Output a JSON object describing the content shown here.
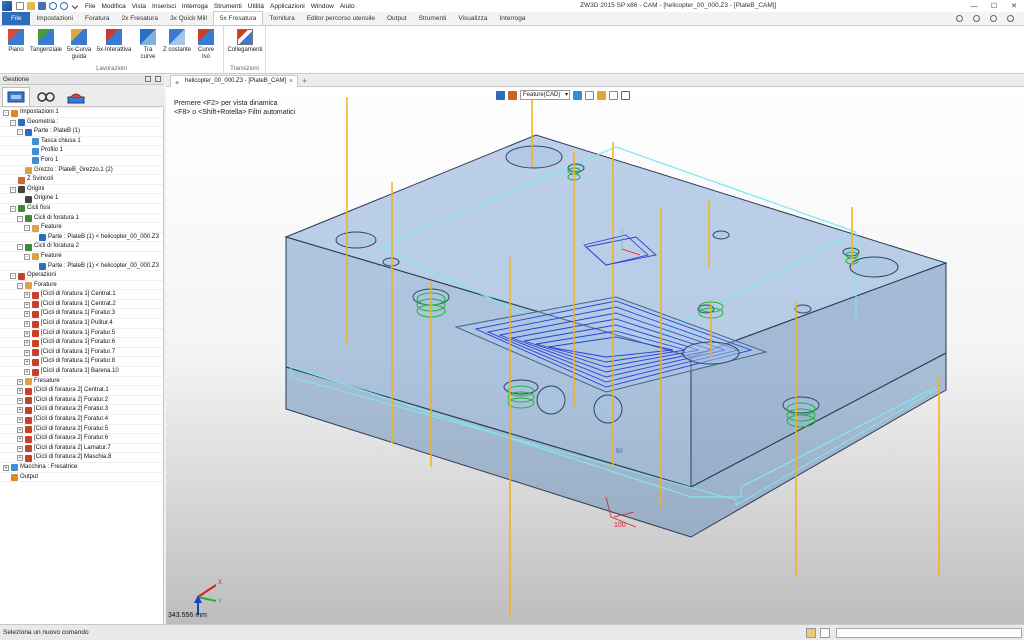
{
  "app": {
    "title": "ZW3D 2015 SP x86 - CAM - [helicopter_00_000.Z3 - [PlateB_CAM]]",
    "menu": [
      "File",
      "Modifica",
      "Vista",
      "Inserisci",
      "Interroga",
      "Strumenti",
      "Utilità",
      "Applicazioni",
      "Window",
      "Aiuto"
    ]
  },
  "ribbon": {
    "tabs": [
      "File",
      "Impostazioni",
      "Foratura",
      "2x Fresatura",
      "3x Quick Mill",
      "5x Fresatura",
      "Tornitura",
      "Editor percorso utensile",
      "Output",
      "Strumenti",
      "Visualizza",
      "Interroga"
    ],
    "active_tab": "5x Fresatura",
    "groups": [
      {
        "label": "Lavorazioni",
        "buttons": [
          {
            "label": "Piano",
            "icon": "plane-icon"
          },
          {
            "label": "Tangenziale",
            "icon": "tangential-icon"
          },
          {
            "label": "5x-Curva guida",
            "icon": "guide-curve-icon"
          },
          {
            "label": "5x-Interattiva",
            "icon": "interactive-icon"
          },
          {
            "label": "Tra curve",
            "icon": "between-curves-icon"
          },
          {
            "label": "Z costante",
            "icon": "z-constant-icon"
          },
          {
            "label": "Curve Iso",
            "icon": "iso-curve-icon"
          }
        ]
      },
      {
        "label": "Transizioni",
        "buttons": [
          {
            "label": "Collegamenti",
            "icon": "links-icon"
          }
        ]
      }
    ]
  },
  "left_panel": {
    "title": "Gestione",
    "tabs": [
      "manager-icon",
      "view-icon",
      "cam-icon"
    ],
    "tree": [
      {
        "label": "Impostazioni 1",
        "level": 0,
        "exp": "-",
        "icon": "#d98a2a"
      },
      {
        "label": "Geometria :",
        "level": 1,
        "exp": "-",
        "icon": "#2a6fc2"
      },
      {
        "label": "Parte : PlateB (1)",
        "level": 2,
        "exp": "-",
        "icon": "#2a6fc2"
      },
      {
        "label": "Tasca chiusa 1",
        "level": 3,
        "exp": "",
        "icon": "#3d8fd6"
      },
      {
        "label": "Profilo 1",
        "level": 3,
        "exp": "",
        "icon": "#3d8fd6"
      },
      {
        "label": "Foro 1",
        "level": 3,
        "exp": "",
        "icon": "#3d8fd6"
      },
      {
        "label": "Grezzo : PlateB_Grezzo.1 (2)",
        "level": 2,
        "exp": "",
        "icon": "#d9a24a"
      },
      {
        "label": "Z Svincoli",
        "level": 1,
        "exp": "",
        "icon": "#c86a2a"
      },
      {
        "label": "Origini",
        "level": 1,
        "exp": "-",
        "icon": "#444444"
      },
      {
        "label": "Origine 1",
        "level": 2,
        "exp": "",
        "icon": "#444444"
      },
      {
        "label": "Cicli fissi",
        "level": 1,
        "exp": "-",
        "icon": "#3a8a3a"
      },
      {
        "label": "Cicli di foratura 1",
        "level": 2,
        "exp": "-",
        "icon": "#3a8a3a"
      },
      {
        "label": "Feature",
        "level": 3,
        "exp": "-",
        "icon": "#d9a24a"
      },
      {
        "label": "Parte : PlateB (1) < helicopter_00_000.Z3",
        "level": 4,
        "exp": "",
        "icon": "#2a6fc2"
      },
      {
        "label": "Cicli di foratura 2",
        "level": 2,
        "exp": "-",
        "icon": "#3a8a3a"
      },
      {
        "label": "Feature",
        "level": 3,
        "exp": "-",
        "icon": "#d9a24a"
      },
      {
        "label": "Parte : PlateB (1) < helicopter_00_000.Z3",
        "level": 4,
        "exp": "",
        "icon": "#2a6fc2"
      },
      {
        "label": "Operazioni",
        "level": 1,
        "exp": "-",
        "icon": "#c8402a"
      },
      {
        "label": "Forature",
        "level": 2,
        "exp": "-",
        "icon": "#d9a24a"
      },
      {
        "label": "[Cicli di foratura 1] Centrat.1",
        "level": 3,
        "exp": "+",
        "icon": "#c8402a"
      },
      {
        "label": "[Cicli di foratura 1] Centrat.2",
        "level": 3,
        "exp": "+",
        "icon": "#c8402a"
      },
      {
        "label": "[Cicli di foratura 1] Foratur.3",
        "level": 3,
        "exp": "+",
        "icon": "#c8402a"
      },
      {
        "label": "[Cicli di foratura 1] Pulitur.4",
        "level": 3,
        "exp": "+",
        "icon": "#c8402a"
      },
      {
        "label": "[Cicli di foratura 1] Foratur.5",
        "level": 3,
        "exp": "+",
        "icon": "#c8402a"
      },
      {
        "label": "[Cicli di foratura 1] Foratur.6",
        "level": 3,
        "exp": "+",
        "icon": "#c8402a"
      },
      {
        "label": "[Cicli di foratura 1] Foratur.7",
        "level": 3,
        "exp": "+",
        "icon": "#c8402a"
      },
      {
        "label": "[Cicli di foratura 1] Foratur.8",
        "level": 3,
        "exp": "+",
        "icon": "#c8402a"
      },
      {
        "label": "[Cicli di foratura 1] Barena.10",
        "level": 3,
        "exp": "+",
        "icon": "#c8402a"
      },
      {
        "label": "Fresature",
        "level": 2,
        "exp": "+",
        "icon": "#d9a24a"
      },
      {
        "label": "[Cicli di foratura 2] Centrat.1",
        "level": 2,
        "exp": "+",
        "icon": "#c8402a"
      },
      {
        "label": "[Cicli di foratura 2] Foratur.2",
        "level": 2,
        "exp": "+",
        "icon": "#c8402a"
      },
      {
        "label": "[Cicli di foratura 2] Foratur.3",
        "level": 2,
        "exp": "+",
        "icon": "#c8402a"
      },
      {
        "label": "[Cicli di foratura 2] Foratur.4",
        "level": 2,
        "exp": "+",
        "icon": "#c8402a"
      },
      {
        "label": "[Cicli di foratura 2] Foratur.5",
        "level": 2,
        "exp": "+",
        "icon": "#c8402a"
      },
      {
        "label": "[Cicli di foratura 2] Foratur.6",
        "level": 2,
        "exp": "+",
        "icon": "#c8402a"
      },
      {
        "label": "[Cicli di foratura 2] Lamatur.7",
        "level": 2,
        "exp": "+",
        "icon": "#c8402a"
      },
      {
        "label": "[Cicli di foratura 2] Maschia.8",
        "level": 2,
        "exp": "+",
        "icon": "#c8402a"
      },
      {
        "label": "Macchina : Fresatrice",
        "level": 0,
        "exp": "+",
        "icon": "#3d8fd6"
      },
      {
        "label": "Output",
        "level": 0,
        "exp": "",
        "icon": "#d98a2a"
      }
    ]
  },
  "document": {
    "tab_label": "helicopter_00_000.Z3 - [PlateB_CAM]"
  },
  "viewport": {
    "hint_line1": "Premere <F2> per vista dinamica",
    "hint_line2": "<F8> o <Shift+Rotella> Filtri automatici",
    "filter_value": "Feature(CAD)",
    "scale_text": "343.556 mm",
    "dim_label_100": "100",
    "dim_label_50": "50",
    "colors": {
      "part_fill": "#7fa7d4",
      "part_edge": "#39506e",
      "stock_edge": "#7fe7f0",
      "tool_axis": "#f2b21a",
      "toolpath": "#2b3fd6",
      "thread": "#22b33a",
      "dimension": "#d92020"
    }
  },
  "status": {
    "text": "Seleziona un nuovo comando"
  }
}
